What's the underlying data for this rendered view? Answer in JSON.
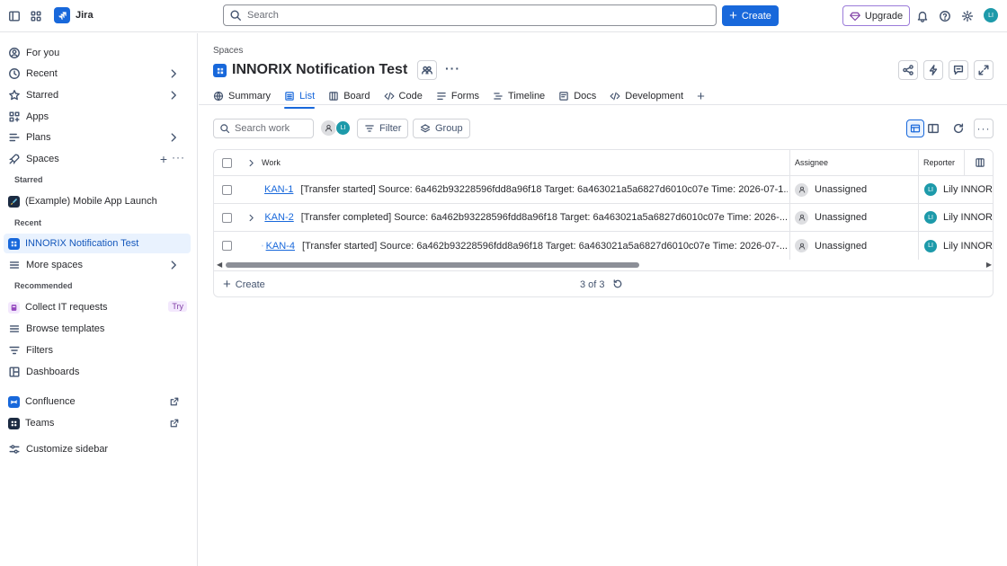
{
  "topbar": {
    "app_name": "Jira",
    "search_placeholder": "Search",
    "create_label": "Create",
    "upgrade_label": "Upgrade",
    "avatar_initials": "LI"
  },
  "sidebar": {
    "items": {
      "for_you": "For you",
      "recent": "Recent",
      "starred": "Starred",
      "apps": "Apps",
      "plans": "Plans",
      "spaces": "Spaces",
      "mobile_app": "(Example) Mobile App Launch",
      "innorix": "INNORIX Notification Test",
      "more_spaces": "More spaces",
      "collect_it": "Collect IT requests",
      "try_badge": "Try",
      "browse_templates": "Browse templates",
      "filters": "Filters",
      "dashboards": "Dashboards",
      "confluence": "Confluence",
      "teams": "Teams",
      "customize": "Customize sidebar"
    },
    "sections": {
      "starred": "Starred",
      "recent": "Recent",
      "recommended": "Recommended"
    }
  },
  "main": {
    "breadcrumb": "Spaces",
    "title": "INNORIX Notification Test",
    "tabs": [
      "Summary",
      "List",
      "Board",
      "Code",
      "Forms",
      "Timeline",
      "Docs",
      "Development"
    ],
    "active_tab": "List",
    "toolbar": {
      "search_placeholder": "Search work",
      "avatar_initials": "LI",
      "filter_label": "Filter",
      "group_label": "Group"
    },
    "table": {
      "columns": {
        "work": "Work",
        "assignee": "Assignee",
        "reporter": "Reporter"
      },
      "rows": [
        {
          "key": "KAN-1",
          "summary": "[Transfer started] Source: 6a462b93228596fdd8a96f18 Target: 6a463021a5a6827d6010c07e Time: 2026-07-1...",
          "assignee": "Unassigned",
          "reporter": "Lily INNORI",
          "reporter_initials": "LI"
        },
        {
          "key": "KAN-2",
          "summary": "[Transfer completed] Source: 6a462b93228596fdd8a96f18 Target: 6a463021a5a6827d6010c07e Time: 2026-...",
          "assignee": "Unassigned",
          "reporter": "Lily INNORI",
          "reporter_initials": "LI"
        },
        {
          "key": "KAN-4",
          "summary": "[Transfer started] Source: 6a462b93228596fdd8a96f18 Target: 6a463021a5a6827d6010c07e Time: 2026-07-...",
          "assignee": "Unassigned",
          "reporter": "Lily INNORI",
          "reporter_initials": "LI"
        }
      ],
      "create_label": "Create",
      "count": "3 of 3"
    }
  },
  "colors": {
    "brand": "#1868db",
    "upgrade_border": "#9b7bd9",
    "avatar": "#1d9aaa",
    "selected_bg": "#e9f2fe"
  },
  "icons": [
    "sidebar-toggle-icon",
    "app-switcher-icon",
    "jira-logo",
    "search-icon",
    "plus-icon",
    "gem-icon",
    "bell-icon",
    "help-icon",
    "settings-icon",
    "person-icon",
    "clock-icon",
    "star-icon",
    "grid-icon",
    "plans-icon",
    "rocket-icon",
    "chevron-right-icon",
    "more-icon",
    "share-icon",
    "bolt-icon",
    "feedback-icon",
    "expand-icon",
    "globe-icon",
    "list-icon",
    "board-icon",
    "code-icon",
    "forms-icon",
    "timeline-icon",
    "docs-icon",
    "development-icon",
    "filter-icon",
    "layers-icon",
    "refresh-icon",
    "checkbox-icon",
    "task-icon",
    "story-icon",
    "columns-icon"
  ]
}
